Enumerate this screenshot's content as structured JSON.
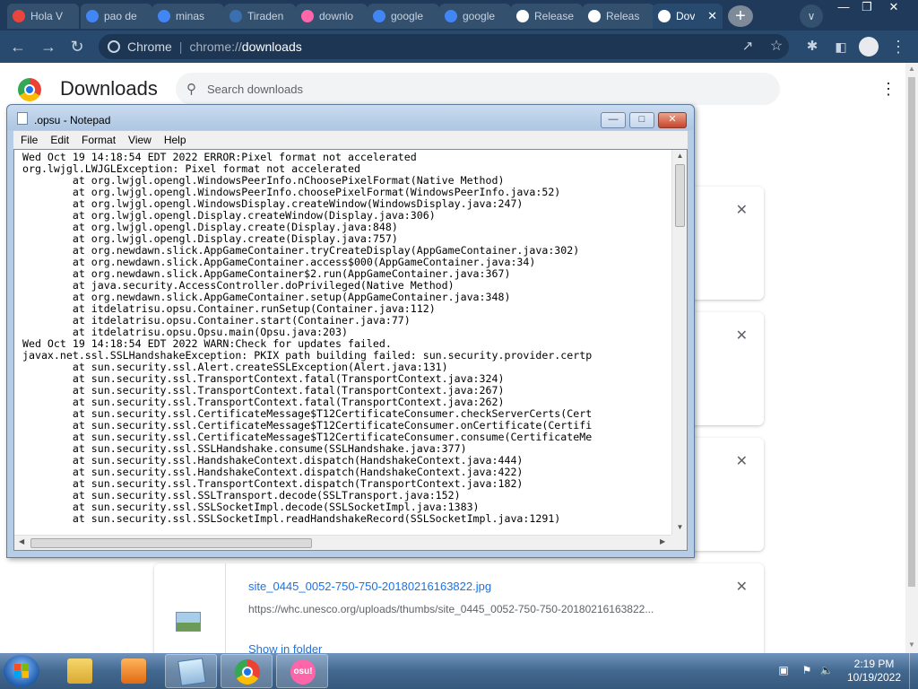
{
  "browser": {
    "tabs": [
      {
        "title": "Hola V",
        "favicon_color": "#e8453c"
      },
      {
        "title": "pao de",
        "favicon_color": "#4285f4"
      },
      {
        "title": "minas",
        "favicon_color": "#4285f4"
      },
      {
        "title": "Tiraden",
        "favicon_color": "#3a6fb0"
      },
      {
        "title": "downlo",
        "favicon_color": "#ff66aa"
      },
      {
        "title": "google",
        "favicon_color": "#4285f4"
      },
      {
        "title": "google",
        "favicon_color": "#4285f4"
      },
      {
        "title": "Release",
        "favicon_color": "#ffffff"
      },
      {
        "title": "Releas",
        "favicon_color": "#ffffff"
      },
      {
        "title": "Dov",
        "favicon_color": "#ffffff",
        "active": true
      }
    ],
    "new_tab_label": "+",
    "omnibox": {
      "site_label": "Chrome",
      "url_scheme": "chrome://",
      "url_path": "downloads"
    }
  },
  "downloads": {
    "title": "Downloads",
    "search_placeholder": "Search downloads",
    "items": [
      {
        "filename": "site_0445_0052-750-750-20180216163822.jpg",
        "url": "https://whc.unesco.org/uploads/thumbs/site_0445_0052-750-750-20180216163822...",
        "action": "Show in folder"
      }
    ]
  },
  "notepad": {
    "title": ".opsu - Notepad",
    "menu": [
      "File",
      "Edit",
      "Format",
      "View",
      "Help"
    ],
    "lines": [
      "Wed Oct 19 14:18:54 EDT 2022 ERROR:Pixel format not accelerated",
      "org.lwjgl.LWJGLException: Pixel format not accelerated",
      "        at org.lwjgl.opengl.WindowsPeerInfo.nChoosePixelFormat(Native Method)",
      "        at org.lwjgl.opengl.WindowsPeerInfo.choosePixelFormat(WindowsPeerInfo.java:52)",
      "        at org.lwjgl.opengl.WindowsDisplay.createWindow(WindowsDisplay.java:247)",
      "        at org.lwjgl.opengl.Display.createWindow(Display.java:306)",
      "        at org.lwjgl.opengl.Display.create(Display.java:848)",
      "        at org.lwjgl.opengl.Display.create(Display.java:757)",
      "        at org.newdawn.slick.AppGameContainer.tryCreateDisplay(AppGameContainer.java:302)",
      "        at org.newdawn.slick.AppGameContainer.access$000(AppGameContainer.java:34)",
      "        at org.newdawn.slick.AppGameContainer$2.run(AppGameContainer.java:367)",
      "        at java.security.AccessController.doPrivileged(Native Method)",
      "        at org.newdawn.slick.AppGameContainer.setup(AppGameContainer.java:348)",
      "        at itdelatrisu.opsu.Container.runSetup(Container.java:112)",
      "        at itdelatrisu.opsu.Container.start(Container.java:77)",
      "        at itdelatrisu.opsu.Opsu.main(Opsu.java:203)",
      "Wed Oct 19 14:18:54 EDT 2022 WARN:Check for updates failed.",
      "javax.net.ssl.SSLHandshakeException: PKIX path building failed: sun.security.provider.certp",
      "        at sun.security.ssl.Alert.createSSLException(Alert.java:131)",
      "        at sun.security.ssl.TransportContext.fatal(TransportContext.java:324)",
      "        at sun.security.ssl.TransportContext.fatal(TransportContext.java:267)",
      "        at sun.security.ssl.TransportContext.fatal(TransportContext.java:262)",
      "        at sun.security.ssl.CertificateMessage$T12CertificateConsumer.checkServerCerts(Cert",
      "        at sun.security.ssl.CertificateMessage$T12CertificateConsumer.onCertificate(Certifi",
      "        at sun.security.ssl.CertificateMessage$T12CertificateConsumer.consume(CertificateMe",
      "        at sun.security.ssl.SSLHandshake.consume(SSLHandshake.java:377)",
      "        at sun.security.ssl.HandshakeContext.dispatch(HandshakeContext.java:444)",
      "        at sun.security.ssl.HandshakeContext.dispatch(HandshakeContext.java:422)",
      "        at sun.security.ssl.TransportContext.dispatch(TransportContext.java:182)",
      "        at sun.security.ssl.SSLTransport.decode(SSLTransport.java:152)",
      "        at sun.security.ssl.SSLSocketImpl.decode(SSLSocketImpl.java:1383)",
      "        at sun.security.ssl.SSLSocketImpl.readHandshakeRecord(SSLSocketImpl.java:1291)"
    ]
  },
  "taskbar": {
    "clock_time": "2:19 PM",
    "clock_date": "10/19/2022",
    "osu_label": "osu!"
  }
}
